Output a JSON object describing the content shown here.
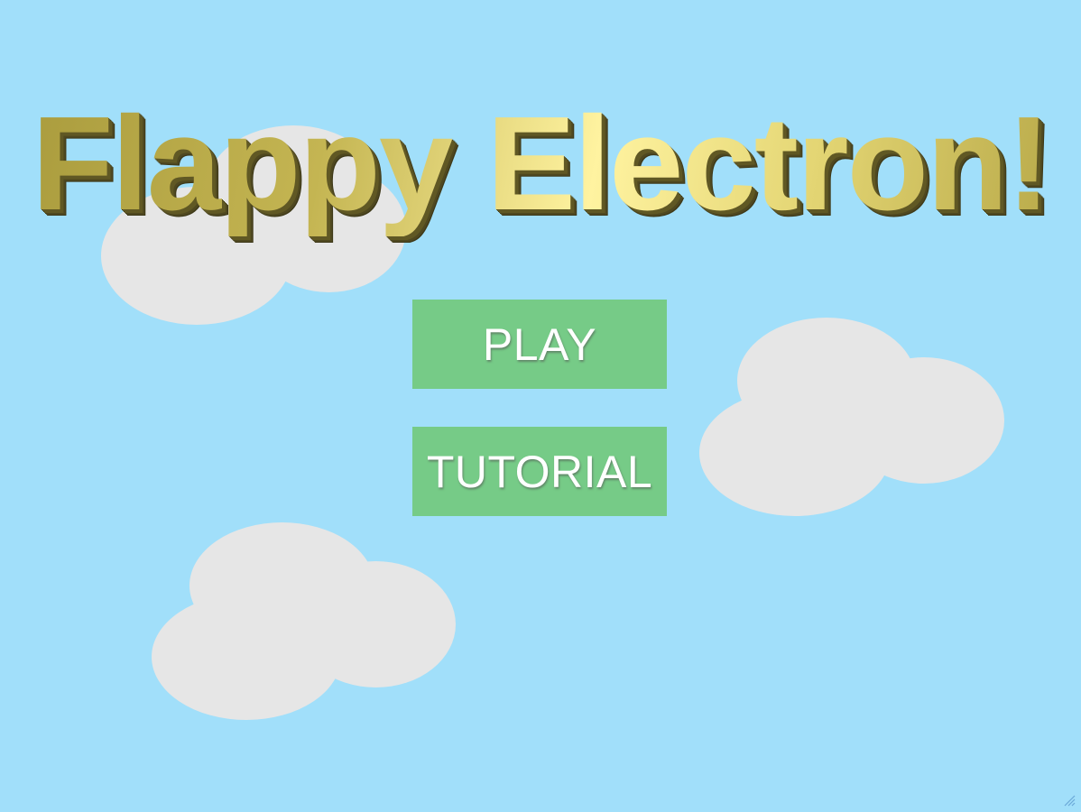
{
  "game": {
    "title": "Flappy Electron!",
    "sky_color": "#a1dffa",
    "cloud_color": "#e6e6e6",
    "title_gold": "#d4c45a"
  },
  "menu": {
    "play_label": "PLAY",
    "tutorial_label": "TUTORIAL",
    "button_color": "#76cb87"
  },
  "window": {
    "resize_handle_icon": "resize-grip-icon"
  }
}
